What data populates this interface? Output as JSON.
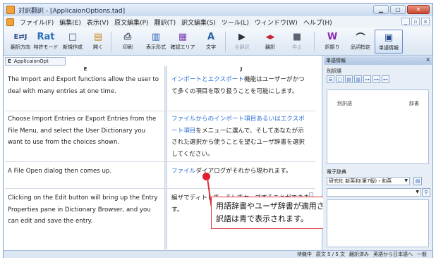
{
  "window": {
    "title": "対訳翻訳 - [ApplicaionOptions.tad]"
  },
  "menu": {
    "items": [
      "ファイル(F)",
      "編集(E)",
      "表示(V)",
      "原文編集(P)",
      "翻訳(T)",
      "訳文編集(S)",
      "ツール(L)",
      "ウィンドウ(W)",
      "ヘルプ(H)"
    ]
  },
  "toolbar": {
    "buttons": [
      {
        "glyph": "E⇄J",
        "label": "翻訳方向"
      },
      {
        "glyph": "Rat",
        "label": "特許モード"
      },
      {
        "glyph": "□",
        "label": "新規作成"
      },
      {
        "glyph": "▤",
        "label": "開く"
      },
      {
        "glyph": "⎙",
        "label": "印刷"
      },
      {
        "glyph": "▥",
        "label": "表示形式"
      },
      {
        "glyph": "▦",
        "label": "確認エリア"
      },
      {
        "glyph": "A",
        "label": "文字"
      },
      {
        "glyph": "▶",
        "label": "全翻訳"
      },
      {
        "glyph": "◂▸",
        "label": "翻訳"
      },
      {
        "glyph": "■",
        "label": "中止"
      },
      {
        "glyph": "W",
        "label": "訳振り"
      },
      {
        "glyph": "⌒",
        "label": "品詞指定"
      },
      {
        "glyph": "▣",
        "label": "単語情報"
      }
    ]
  },
  "document": {
    "tab_letter": "E",
    "tab_name": "ApplicaionOpt",
    "col_e": "E",
    "col_j": "J",
    "rows": [
      {
        "src": "The Import and Export functions allow the user to deal with many entries at one time.",
        "tgt_blue": "インポートとエクスポート",
        "tgt": "機能はユーザーがかつて多くの項目を取り扱うことを可能にします。"
      },
      {
        "src": "Choose Import Entries or Export Entries from the File Menu, and select the User Dictionary you want to use from the choices shown.",
        "tgt_blue": "ファイルからのインポート項目あるいはエクスポート項目",
        "tgt": "をメニューに選んで、そしてあなたが示された選択から使うことを望むユーザ辞書を選択してください。"
      },
      {
        "src": "A File Open dialog then comes up.",
        "tgt_blue": "ファイル",
        "tgt": "ダイアログがそれから現われます。"
      },
      {
        "src": "Clicking on the Edit button will bring up the Entry Properties pane in Dictionary Browser, and you can edit and save the entry.",
        "tgt_blue": "",
        "tgt": "編ザでディトして、そしてセーブすることができます。"
      }
    ]
  },
  "callout": {
    "line1": "用語辞書やユーザ辞書が適用された",
    "line2": "訳語は青で表示されます。"
  },
  "right_panel": {
    "header": "単語情報",
    "section_label": "别訳語",
    "alt_label": "別訳語",
    "word_class_label": "辞書",
    "dict_label": "電子辞典",
    "dict_select": "研究社 新英和(第7版)・和英"
  },
  "status": {
    "state": "待機中",
    "sentence": "原文 5 / 5 文",
    "translated": "翻訳済み",
    "direction": "英語から日本語へ",
    "mode": "一般"
  },
  "colors": {
    "blue_text": "#2a6fd6",
    "callout_border": "#e0323b",
    "marker": "#e11d2e"
  }
}
